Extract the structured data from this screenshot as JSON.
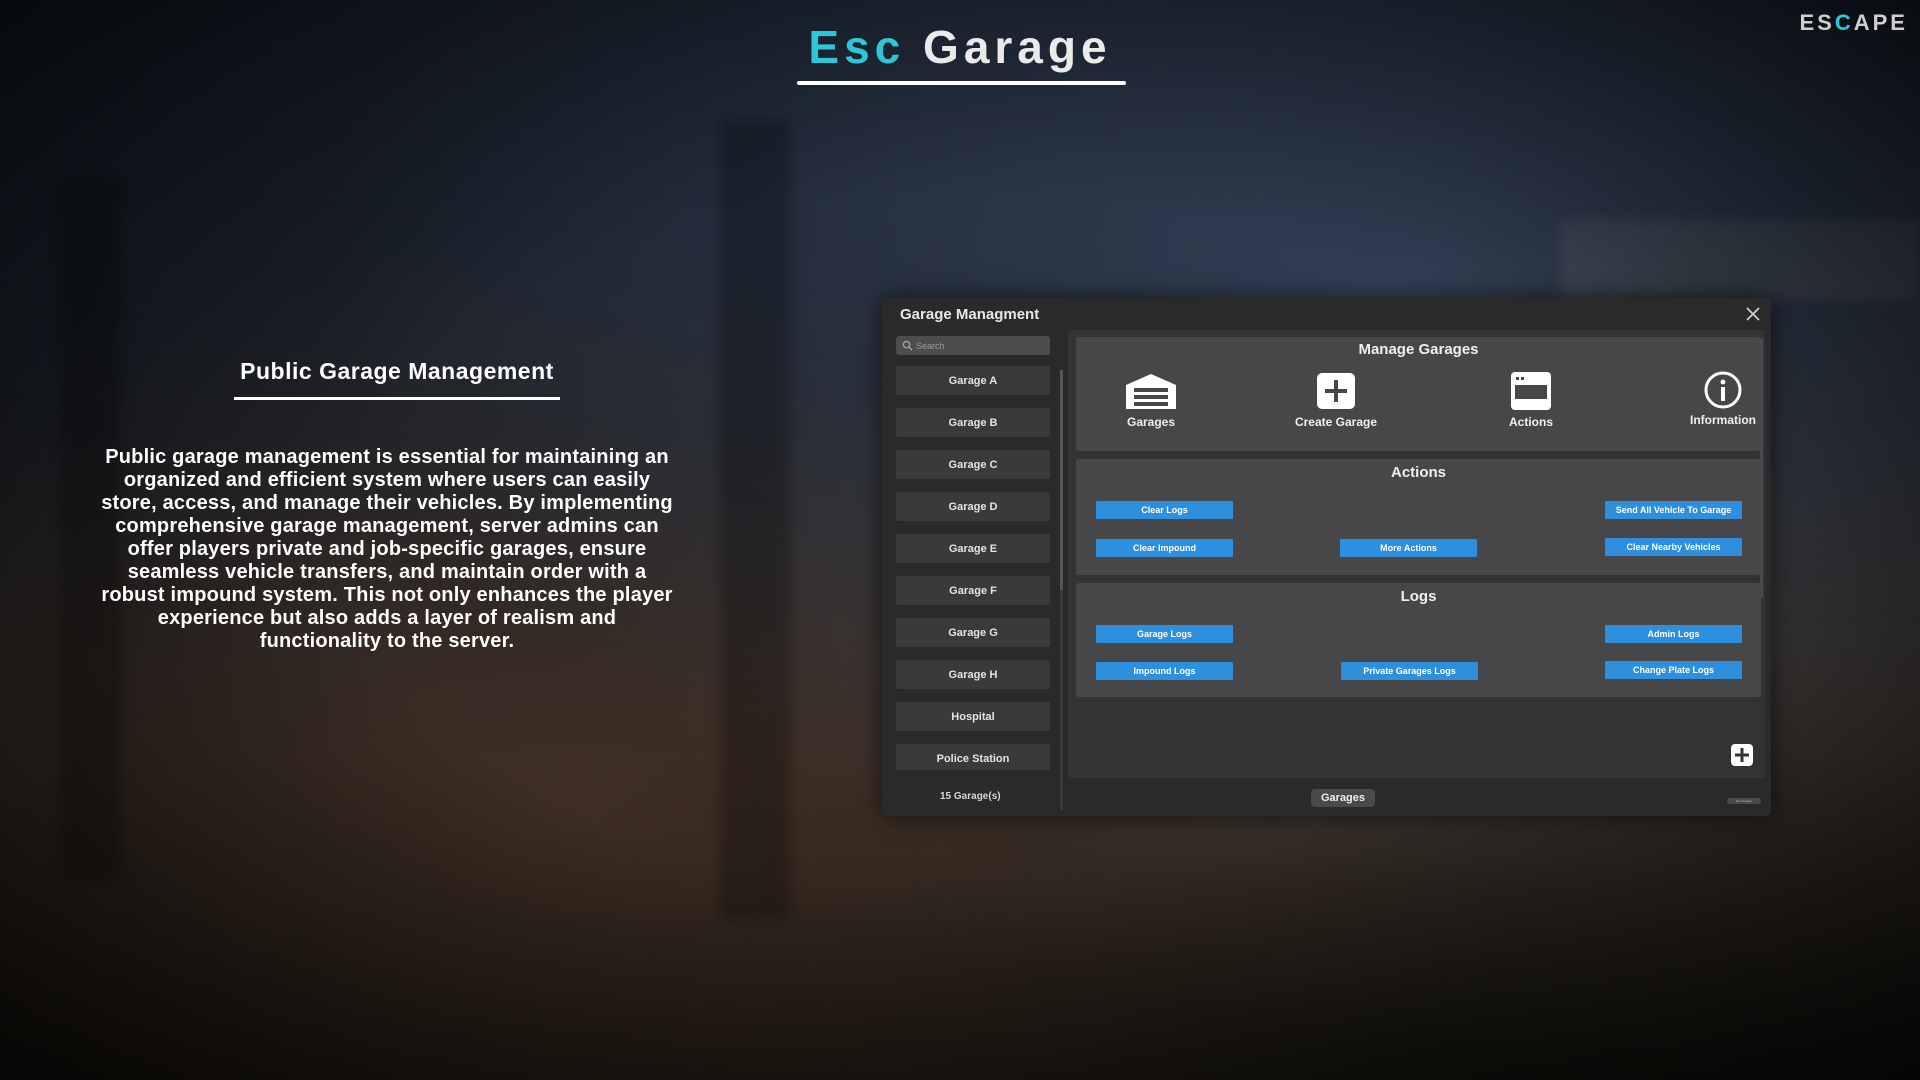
{
  "header": {
    "title_accent": "Esc",
    "title_rest": "Garage",
    "brand_pre": "ES",
    "brand_c": "C",
    "brand_post": "APE"
  },
  "intro": {
    "heading": "Public Garage Management",
    "description": "Public garage management is essential for maintaining an organized and efficient system where users can easily store, access, and manage their vehicles. By implementing comprehensive garage management, server admins can offer players private and job-specific garages, ensure seamless vehicle transfers, and maintain order with a robust impound system. This not only enhances the player experience but also adds a layer of realism and functionality to the server."
  },
  "panel": {
    "title": "Garage Managment",
    "search_placeholder": "Search",
    "garages": [
      "Garage A",
      "Garage B",
      "Garage C",
      "Garage D",
      "Garage E",
      "Garage F",
      "Garage G",
      "Garage H",
      "Hospital",
      "Police Station"
    ],
    "garage_count": "15 Garage(s)",
    "footer_tab": "Garages",
    "footer_tiny_tab": "Esc Garage"
  },
  "manage": {
    "title": "Manage Garages",
    "items": [
      "Garages",
      "Create Garage",
      "Actions",
      "Information"
    ]
  },
  "actions": {
    "title": "Actions",
    "clear_logs": "Clear Logs",
    "send_all": "Send All Vehicle To Garage",
    "clear_impound": "Clear Impound",
    "more_actions": "More Actions",
    "clear_nearby": "Clear Nearby Vehicles"
  },
  "logs": {
    "title": "Logs",
    "garage_logs": "Garage Logs",
    "admin_logs": "Admin Logs",
    "impound_logs": "Impound Logs",
    "private_logs": "Private Garages Logs",
    "plate_logs": "Change Plate Logs"
  },
  "colors": {
    "accent": "#2ec6d6",
    "button": "#2d8fde",
    "panel_bg": "#2a2a2b"
  }
}
